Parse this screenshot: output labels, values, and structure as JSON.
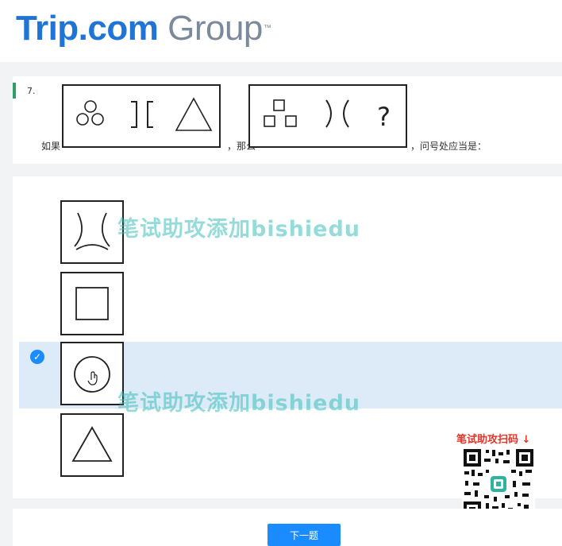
{
  "header": {
    "logo_text_main": "Trip.com",
    "logo_text_group": "Group",
    "logo_tm": "™"
  },
  "question": {
    "number": "7.",
    "text_before": "如果",
    "text_middle": "，那么",
    "text_after": "，问号处应当是：",
    "figure_left": "three circles, ][ brackets, triangle",
    "figure_right": "three squares, )( brackets, ?",
    "question_mark": "?"
  },
  "options": [
    {
      "label": "curved lines figure",
      "selected": false
    },
    {
      "label": "square",
      "selected": false
    },
    {
      "label": "circle",
      "selected": true
    },
    {
      "label": "triangle",
      "selected": false
    }
  ],
  "watermarks": [
    "笔试助攻添加bishiedu",
    "笔试助攻添加bishiedu"
  ],
  "promo": {
    "qr_label": "笔试助攻扫码 ↓"
  },
  "footer": {
    "next_label": "下一题"
  },
  "colors": {
    "accent": "#1a8cff",
    "selected_bg": "#ddebf9",
    "question_bar": "#2f9e6b",
    "logo_blue": "#1f74d6"
  }
}
